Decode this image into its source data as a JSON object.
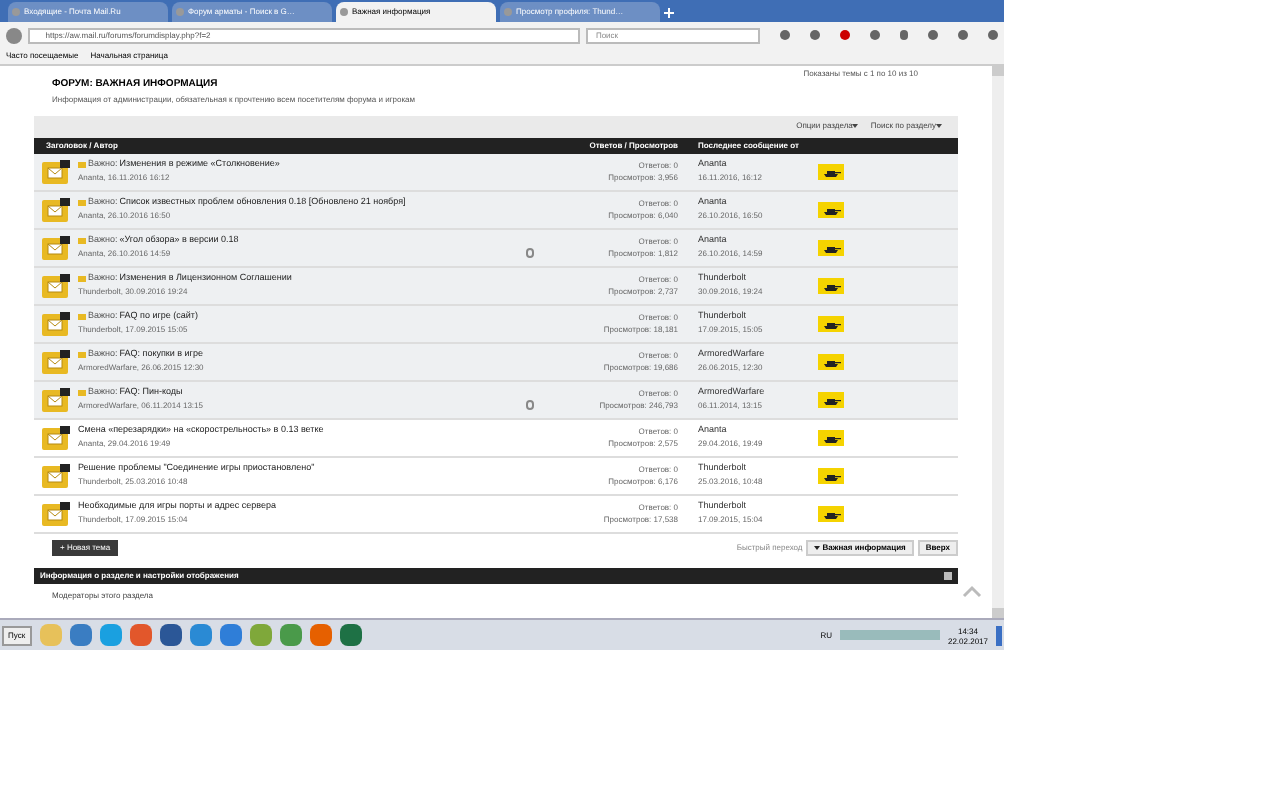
{
  "browser": {
    "tabs": [
      {
        "title": "Входящие - Почта Mail.Ru",
        "selected": false
      },
      {
        "title": "Форум арматы - Поиск в G…",
        "selected": false
      },
      {
        "title": "Важная информация",
        "selected": true
      },
      {
        "title": "Просмотр профиля: Thund…",
        "selected": false
      }
    ],
    "url": "https://aw.mail.ru/forums/forumdisplay.php?f=2",
    "search_placeholder": "Поиск",
    "bookmarks": [
      "Часто посещаемые",
      "Начальная страница"
    ]
  },
  "page": {
    "pager_text": "Показаны темы с 1 по 10 из 10",
    "title": "ФОРУМ: ВАЖНАЯ ИНФОРМАЦИЯ",
    "description": "Информация от администрации, обязательная к прочтению всем посетителям форума и игрокам",
    "options": [
      "Опции раздела",
      "Поиск по разделу"
    ],
    "columns": [
      "Заголовок / Автор",
      "Ответов / Просмотров",
      "Последнее сообщение от"
    ],
    "topics": [
      {
        "pinned": true,
        "prefix": "Важно:",
        "title": "Изменения в режиме «Столкновение»",
        "author_date": "Ananta, 16.11.2016 16:12",
        "attachment": false,
        "replies": "Ответов: 0",
        "views": "Просмотров: 3,956",
        "last_author": "Ananta",
        "last_date": "16.11.2016, 16:12"
      },
      {
        "pinned": true,
        "prefix": "Важно:",
        "title": "Список известных проблем обновления 0.18 [Обновлено 21 ноября]",
        "author_date": "Ananta, 26.10.2016 16:50",
        "attachment": false,
        "replies": "Ответов: 0",
        "views": "Просмотров: 6,040",
        "last_author": "Ananta",
        "last_date": "26.10.2016, 16:50"
      },
      {
        "pinned": true,
        "prefix": "Важно:",
        "title": "«Угол обзора» в версии 0.18",
        "author_date": "Ananta, 26.10.2016 14:59",
        "attachment": true,
        "replies": "Ответов: 0",
        "views": "Просмотров: 1,812",
        "last_author": "Ananta",
        "last_date": "26.10.2016, 14:59"
      },
      {
        "pinned": true,
        "prefix": "Важно:",
        "title": "Изменения в Лицензионном Соглашении",
        "author_date": "Thunderbolt, 30.09.2016 19:24",
        "attachment": false,
        "replies": "Ответов: 0",
        "views": "Просмотров: 2,737",
        "last_author": "Thunderbolt",
        "last_date": "30.09.2016, 19:24"
      },
      {
        "pinned": true,
        "prefix": "Важно:",
        "title": "FAQ по игре (сайт)",
        "author_date": "Thunderbolt, 17.09.2015 15:05",
        "attachment": false,
        "replies": "Ответов: 0",
        "views": "Просмотров: 18,181",
        "last_author": "Thunderbolt",
        "last_date": "17.09.2015, 15:05"
      },
      {
        "pinned": true,
        "prefix": "Важно:",
        "title": "FAQ: покупки в игре",
        "author_date": "ArmoredWarfare, 26.06.2015 12:30",
        "attachment": false,
        "replies": "Ответов: 0",
        "views": "Просмотров: 19,686",
        "last_author": "ArmoredWarfare",
        "last_date": "26.06.2015, 12:30"
      },
      {
        "pinned": true,
        "prefix": "Важно:",
        "title": "FAQ: Пин-коды",
        "author_date": "ArmoredWarfare, 06.11.2014 13:15",
        "attachment": true,
        "replies": "Ответов: 0",
        "views": "Просмотров: 246,793",
        "last_author": "ArmoredWarfare",
        "last_date": "06.11.2014, 13:15"
      },
      {
        "pinned": false,
        "title": "Смена «перезарядки» на «скорострельность» в 0.13 ветке",
        "author_date": "Ananta, 29.04.2016 19:49",
        "attachment": false,
        "replies": "Ответов: 0",
        "views": "Просмотров: 2,575",
        "last_author": "Ananta",
        "last_date": "29.04.2016, 19:49"
      },
      {
        "pinned": false,
        "title": "Решение проблемы \"Соединение игры приостановлено\"",
        "author_date": "Thunderbolt, 25.03.2016 10:48",
        "attachment": false,
        "replies": "Ответов: 0",
        "views": "Просмотров: 6,176",
        "last_author": "Thunderbolt",
        "last_date": "25.03.2016, 10:48"
      },
      {
        "pinned": false,
        "title": "Необходимые для игры порты и адрес сервера",
        "author_date": "Thunderbolt, 17.09.2015 15:04",
        "attachment": false,
        "replies": "Ответов: 0",
        "views": "Просмотров: 17,538",
        "last_author": "Thunderbolt",
        "last_date": "17.09.2015, 15:04"
      }
    ],
    "new_topic_button": "+ Новая тема",
    "quick_nav_label": "Быстрый переход",
    "quick_nav_value": "Важная информация",
    "top_button": "Вверх",
    "info_bar_title": "Информация о разделе и настройки отображения",
    "moderators_label": "Модераторы этого раздела"
  },
  "taskbar": {
    "start": "Пуск",
    "language": "RU",
    "time": "14:34",
    "date": "22.02.2017"
  }
}
